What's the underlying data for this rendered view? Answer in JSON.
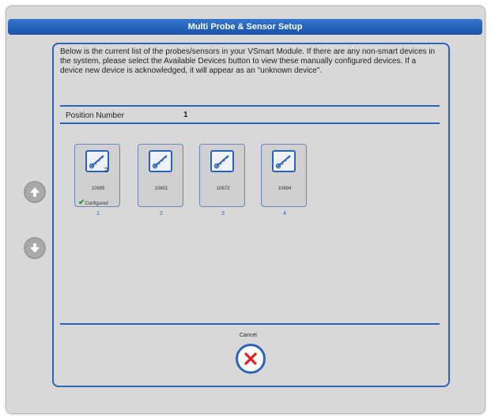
{
  "window": {
    "title": "Multi Probe & Sensor Setup"
  },
  "intro_text": "Below is the current list of the probes/sensors in your VSmart Module.  If there are any non-smart devices in the system, please select the Available Devices button to view these manually configured devices.  If a device new device is acknowledged, it will appear as an \"unknown device\".",
  "position": {
    "label": "Position Number",
    "value": "1"
  },
  "devices": [
    {
      "serial": "10695",
      "position": "1",
      "badge": "2",
      "status": "Configured",
      "icon": "probe-icon"
    },
    {
      "serial": "10601",
      "position": "2",
      "badge": "",
      "status": "",
      "icon": "probe-icon"
    },
    {
      "serial": "10673",
      "position": "3",
      "badge": "",
      "status": "",
      "icon": "probe-icon"
    },
    {
      "serial": "10694",
      "position": "4",
      "badge": "",
      "status": "",
      "icon": "probe-icon"
    }
  ],
  "navigation": {
    "up_icon": "arrow-up-icon",
    "down_icon": "arrow-down-icon"
  },
  "cancel": {
    "label": "Cancel",
    "icon": "close-icon"
  },
  "colors": {
    "accent": "#2c63b8",
    "title_bar": "#1a53a8",
    "background": "#d8d8d8",
    "check": "#2a9a2a",
    "cancel_x": "#e02020"
  }
}
